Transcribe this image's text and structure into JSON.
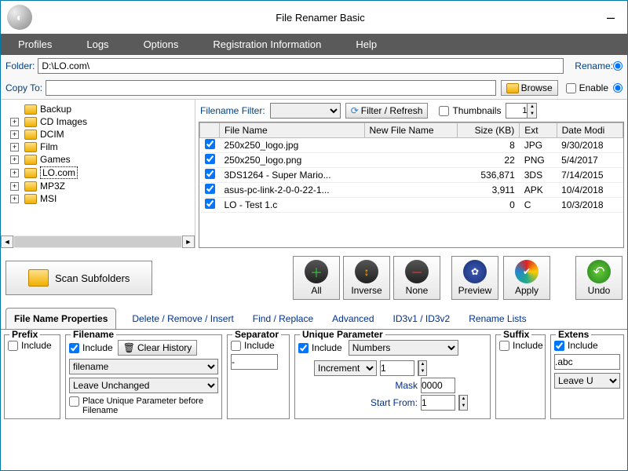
{
  "title": "File Renamer Basic",
  "menu": {
    "profiles": "Profiles",
    "logs": "Logs",
    "options": "Options",
    "reg": "Registration Information",
    "help": "Help"
  },
  "folder": {
    "label": "Folder:",
    "path": "D:\\LO.com\\"
  },
  "rename_label": "Rename:",
  "copyto": {
    "label": "Copy To:",
    "path": "",
    "browse": "Browse",
    "enable": "Enable"
  },
  "tree": [
    "Backup",
    "CD Images",
    "DCIM",
    "Film",
    "Games",
    "LO.com",
    "MP3Z",
    "MSI"
  ],
  "tree_selected": "LO.com",
  "filter": {
    "label": "Filename Filter:",
    "btn": "Filter / Refresh",
    "thumb": "Thumbnails",
    "spin": "1"
  },
  "grid": {
    "headers": [
      "File Name",
      "New File Name",
      "Size (KB)",
      "Ext",
      "Date Modi"
    ],
    "rows": [
      {
        "name": "250x250_logo.jpg",
        "size": "8",
        "ext": "JPG",
        "date": "9/30/2018"
      },
      {
        "name": "250x250_logo.png",
        "size": "22",
        "ext": "PNG",
        "date": "5/4/2017"
      },
      {
        "name": "3DS1264 - Super Mario...",
        "size": "536,871",
        "ext": "3DS",
        "date": "7/14/2015"
      },
      {
        "name": "asus-pc-link-2-0-0-22-1...",
        "size": "3,911",
        "ext": "APK",
        "date": "10/4/2018"
      },
      {
        "name": "LO - Test 1.c",
        "size": "0",
        "ext": "C",
        "date": "10/3/2018"
      }
    ]
  },
  "scan": "Scan Subfolders",
  "sel": {
    "all": "All",
    "inverse": "Inverse",
    "none": "None"
  },
  "act": {
    "preview": "Preview",
    "apply": "Apply",
    "undo": "Undo"
  },
  "tabs": {
    "main": "File Name Properties",
    "del": "Delete / Remove / Insert",
    "find": "Find / Replace",
    "adv": "Advanced",
    "id3": "ID3v1 / ID3v2",
    "lists": "Rename Lists"
  },
  "prefix": {
    "legend": "Prefix",
    "include": "Include"
  },
  "filename": {
    "legend": "Filename",
    "include": "Include",
    "clear": "Clear History",
    "combo1": "filename",
    "combo2": "Leave Unchanged",
    "place": "Place Unique Parameter before Filename"
  },
  "sep": {
    "legend": "Separator",
    "include": "Include",
    "val": "-"
  },
  "unique": {
    "legend": "Unique Parameter",
    "include": "Include",
    "type": "Numbers",
    "mode": "Increment",
    "start_val": "1",
    "mask_lbl": "Mask",
    "mask_val": "0000",
    "startfrom_lbl": "Start From:",
    "startfrom_val": "1"
  },
  "suffix": {
    "legend": "Suffix",
    "include": "Include"
  },
  "ext": {
    "legend": "Extens",
    "include": "Include",
    "val": ".abc",
    "combo": "Leave U"
  }
}
